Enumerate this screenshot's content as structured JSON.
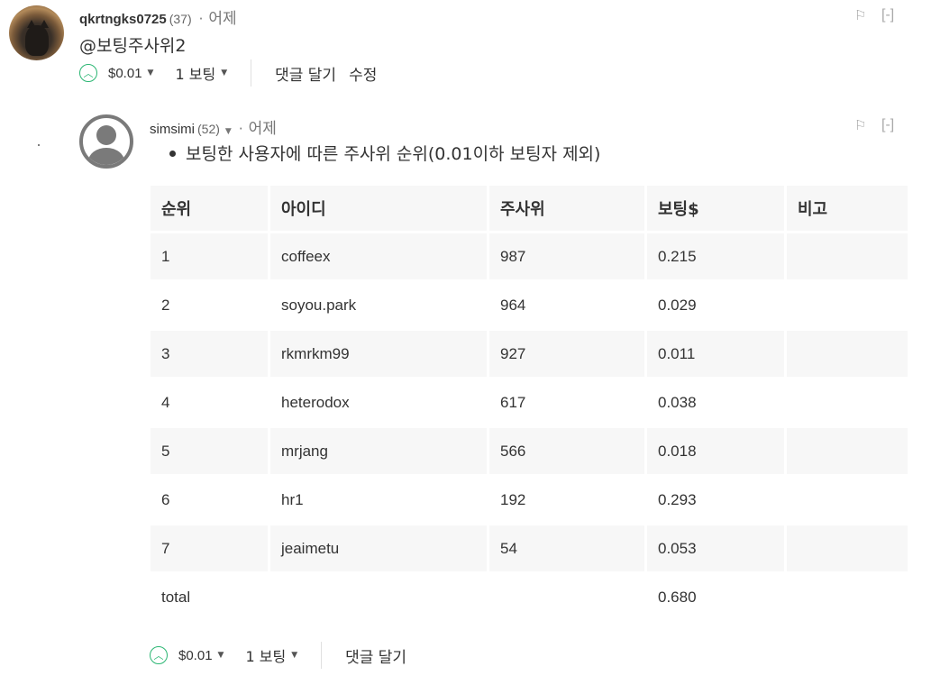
{
  "comment1": {
    "username": "qkrtngks0725",
    "reputation": "(37)",
    "separator": "·",
    "time": "어제",
    "body": "@보팅주사위2",
    "amount": "$0.01",
    "votes": "1 보팅",
    "reply": "댓글 달기",
    "edit": "수정",
    "collapse": "[-]"
  },
  "comment2": {
    "username": "simsimi",
    "reputation": "(52)",
    "separator": "·",
    "time": "어제",
    "bullet_text": "보팅한 사용자에 따른 주사위 순위(0.01이하 보팅자 제외)",
    "amount": "$0.01",
    "votes": "1 보팅",
    "reply": "댓글 달기",
    "collapse": "[-]"
  },
  "table": {
    "headers": [
      "순위",
      "아이디",
      "주사위",
      "보팅$",
      "비고"
    ],
    "rows": [
      [
        "1",
        "coffeex",
        "987",
        "0.215",
        ""
      ],
      [
        "2",
        "soyou.park",
        "964",
        "0.029",
        ""
      ],
      [
        "3",
        "rkmrkm99",
        "927",
        "0.011",
        ""
      ],
      [
        "4",
        "heterodox",
        "617",
        "0.038",
        ""
      ],
      [
        "5",
        "mrjang",
        "566",
        "0.018",
        ""
      ],
      [
        "6",
        "hr1",
        "192",
        "0.293",
        ""
      ],
      [
        "7",
        "jeaimetu",
        "54",
        "0.053",
        ""
      ],
      [
        "total",
        "",
        "",
        "0.680",
        ""
      ]
    ]
  },
  "colors": {
    "upvote": "#2bb673",
    "row_shade": "#f7f7f7",
    "muted": "#777777"
  },
  "icons": {
    "upvote": "chevron-up-circle-icon",
    "flag": "flag-icon",
    "dropdown": "caret-down-icon"
  }
}
